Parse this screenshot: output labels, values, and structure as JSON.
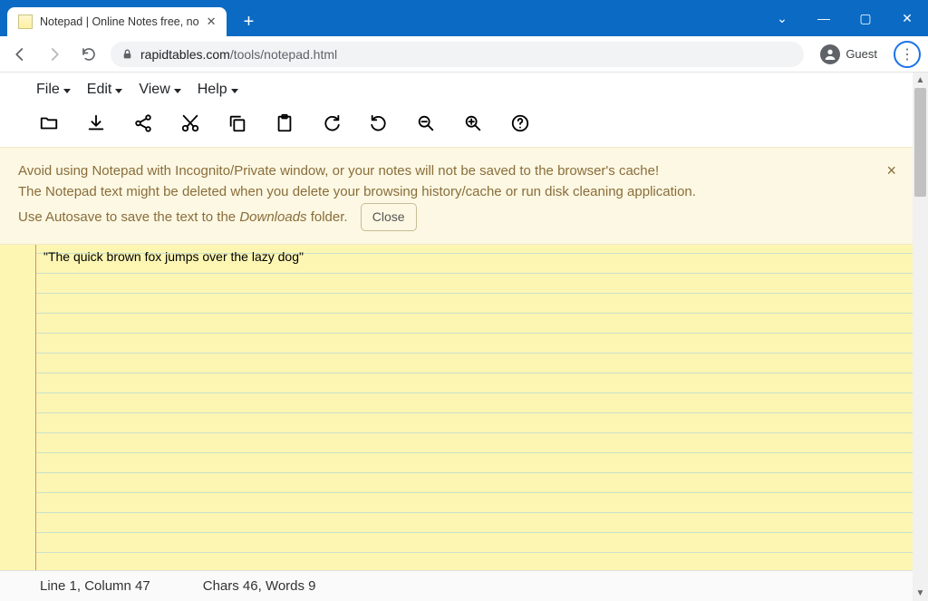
{
  "browser": {
    "tab_title": "Notepad | Online Notes free, no",
    "url_domain": "rapidtables.com",
    "url_path": "/tools/notepad.html",
    "profile_label": "Guest"
  },
  "menubar": {
    "file": "File",
    "edit": "Edit",
    "view": "View",
    "help": "Help"
  },
  "banner": {
    "line1": "Avoid using Notepad with Incognito/Private window, or your notes will not be saved to the browser's cache!",
    "line2": "The Notepad text might be deleted when you delete your browsing history/cache or run disk cleaning application.",
    "line3_pre": "Use Autosave to save the text to the ",
    "line3_em": "Downloads",
    "line3_post": " folder.",
    "close_btn": "Close"
  },
  "notepad": {
    "text": "\"The quick brown fox jumps over the lazy dog\""
  },
  "status": {
    "line_col": "Line 1, Column 47",
    "chars_words": "Chars 46, Words 9"
  }
}
